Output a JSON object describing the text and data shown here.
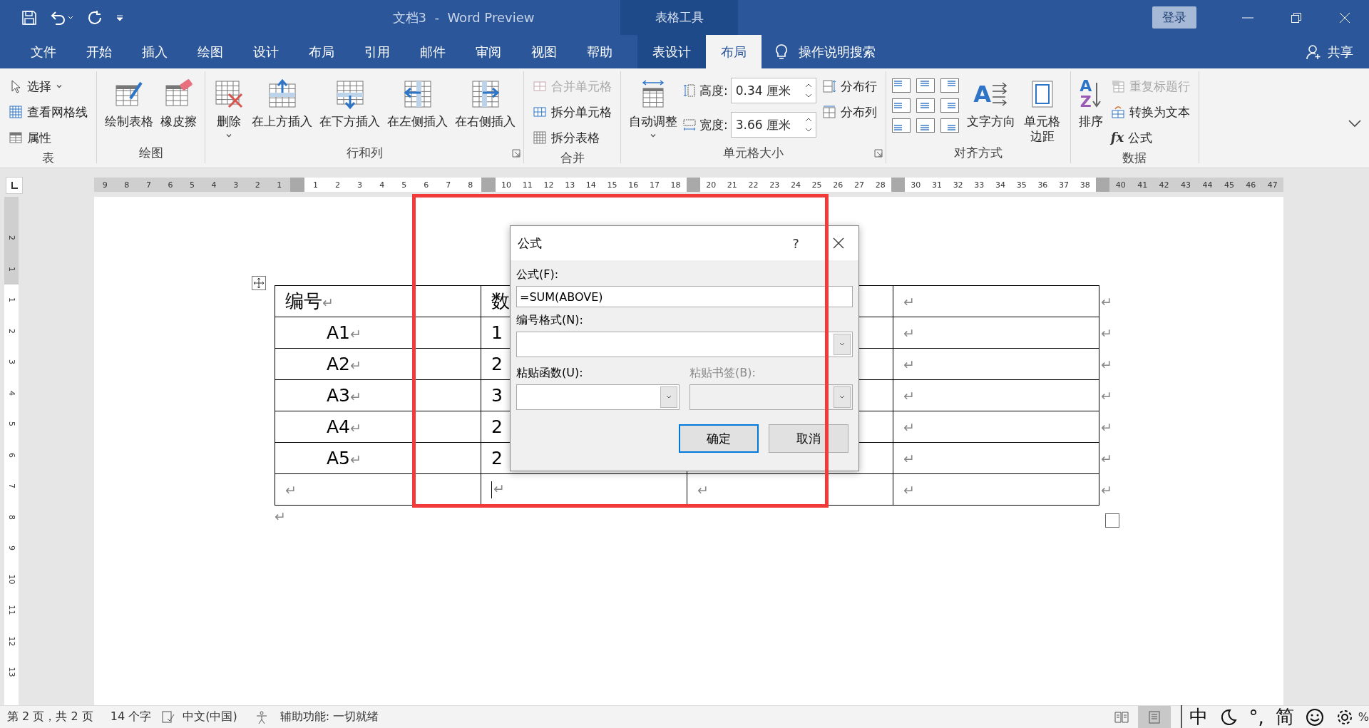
{
  "title_bar": {
    "title": "文档3  -  Word Preview",
    "context_label": "表格工具",
    "login": "登录"
  },
  "menu_tabs": [
    {
      "label": "文件",
      "selected": false,
      "kind": "plain"
    },
    {
      "label": "开始",
      "selected": false,
      "kind": "plain"
    },
    {
      "label": "插入",
      "selected": false,
      "kind": "plain"
    },
    {
      "label": "绘图",
      "selected": false,
      "kind": "plain"
    },
    {
      "label": "设计",
      "selected": false,
      "kind": "plain"
    },
    {
      "label": "布局",
      "selected": false,
      "kind": "plain"
    },
    {
      "label": "引用",
      "selected": false,
      "kind": "plain"
    },
    {
      "label": "邮件",
      "selected": false,
      "kind": "plain"
    },
    {
      "label": "审阅",
      "selected": false,
      "kind": "plain"
    },
    {
      "label": "视图",
      "selected": false,
      "kind": "plain"
    },
    {
      "label": "帮助",
      "selected": false,
      "kind": "plain"
    },
    {
      "label": "表设计",
      "selected": false,
      "kind": "context"
    },
    {
      "label": "布局",
      "selected": true,
      "kind": "context"
    }
  ],
  "search": {
    "label": "操作说明搜索"
  },
  "share": {
    "label": "共享"
  },
  "ribbon": {
    "groups": [
      {
        "label": "表",
        "launcher": false,
        "items": [
          {
            "kind": "small",
            "label": "选择",
            "dropdown": true,
            "disabled": false
          },
          {
            "kind": "small",
            "label": "查看网格线",
            "dropdown": false,
            "disabled": false
          },
          {
            "kind": "small",
            "label": "属性",
            "dropdown": false,
            "disabled": false
          }
        ]
      },
      {
        "label": "绘图",
        "launcher": false,
        "items": [
          {
            "kind": "large",
            "label": "绘制表格",
            "dropdown": false
          },
          {
            "kind": "large",
            "label": "橡皮擦",
            "dropdown": false
          }
        ]
      },
      {
        "label": "行和列",
        "launcher": true,
        "items": [
          {
            "kind": "large",
            "label": "删除",
            "dropdown": true
          },
          {
            "kind": "large",
            "label": "在上方插入",
            "dropdown": false
          },
          {
            "kind": "large",
            "label": "在下方插入",
            "dropdown": false
          },
          {
            "kind": "large",
            "label": "在左侧插入",
            "dropdown": false
          },
          {
            "kind": "large",
            "label": "在右侧插入",
            "dropdown": false
          }
        ]
      },
      {
        "label": "合并",
        "launcher": false,
        "items": [
          {
            "kind": "small",
            "label": "合并单元格",
            "dropdown": false,
            "disabled": true
          },
          {
            "kind": "small",
            "label": "拆分单元格",
            "dropdown": false,
            "disabled": false
          },
          {
            "kind": "small",
            "label": "拆分表格",
            "dropdown": false,
            "disabled": false
          }
        ]
      },
      {
        "label": "单元格大小",
        "launcher": true,
        "items": [
          {
            "kind": "large",
            "label": "自动调整",
            "dropdown": true
          },
          {
            "kind": "spinner",
            "label": "高度:",
            "value": "0.34 厘米"
          },
          {
            "kind": "spinner",
            "label": "宽度:",
            "value": "3.66 厘米"
          },
          {
            "kind": "small",
            "label": "分布行",
            "dropdown": false,
            "disabled": false
          },
          {
            "kind": "small",
            "label": "分布列",
            "dropdown": false,
            "disabled": false
          }
        ]
      },
      {
        "label": "对齐方式",
        "launcher": false,
        "items": [
          {
            "kind": "align_grid"
          },
          {
            "kind": "large",
            "label": "文字方向",
            "dropdown": false,
            "glyphs": [
              "A"
            ]
          },
          {
            "kind": "large",
            "label": "单元格边距",
            "dropdown": false,
            "wrap": true
          }
        ]
      },
      {
        "label": "数据",
        "launcher": false,
        "items": [
          {
            "kind": "large",
            "label": "排序",
            "dropdown": false,
            "glyphs": [
              "A",
              "Z"
            ]
          },
          {
            "kind": "small",
            "label": "重复标题行",
            "dropdown": false,
            "disabled": true
          },
          {
            "kind": "small",
            "label": "转换为文本",
            "dropdown": false,
            "disabled": false
          },
          {
            "kind": "small",
            "label": "公式",
            "dropdown": false,
            "disabled": false,
            "glyphs": [
              "fx"
            ]
          }
        ]
      }
    ]
  },
  "horizontal_ruler": {
    "segments": [
      {
        "kind": "margin",
        "labels": [
          "9",
          "8",
          "7",
          "6",
          "5",
          "4",
          "3",
          "2",
          "1"
        ]
      },
      {
        "kind": "column",
        "labels": [
          "1",
          "2",
          "3",
          "4",
          "5",
          "6",
          "7",
          "8"
        ]
      },
      {
        "kind": "column",
        "labels": [
          "10",
          "11",
          "12",
          "13",
          "14",
          "15",
          "16",
          "17",
          "18"
        ]
      },
      {
        "kind": "column",
        "labels": [
          "20",
          "21",
          "22",
          "23",
          "24",
          "25",
          "26",
          "27",
          "28"
        ]
      },
      {
        "kind": "column",
        "labels": [
          "30",
          "31",
          "32",
          "33",
          "34",
          "35",
          "36",
          "37",
          "38"
        ]
      },
      {
        "kind": "margin",
        "labels": [
          "40",
          "41",
          "42",
          "43",
          "44",
          "45",
          "46",
          "47"
        ]
      }
    ]
  },
  "vertical_ruler": {
    "top_labels": [
      "2",
      "1"
    ],
    "labels": [
      "1",
      "2",
      "3",
      "4",
      "5",
      "6",
      "7",
      "8",
      "9",
      "10",
      "11",
      "12",
      "13"
    ]
  },
  "table": {
    "rows": [
      {
        "cells": [
          {
            "text": "编号",
            "mark": "↵"
          },
          {
            "text": "数"
          },
          {},
          {
            "mark": "↵"
          }
        ],
        "end_mark": "↵"
      },
      {
        "cells": [
          {
            "text": "A1",
            "mark": "↵"
          },
          {
            "text": "1"
          },
          {},
          {
            "mark": "↵"
          }
        ],
        "end_mark": "↵"
      },
      {
        "cells": [
          {
            "text": "A2",
            "mark": "↵"
          },
          {
            "text": "2"
          },
          {},
          {
            "mark": "↵"
          }
        ],
        "end_mark": "↵"
      },
      {
        "cells": [
          {
            "text": "A3",
            "mark": "↵"
          },
          {
            "text": "3"
          },
          {},
          {
            "mark": "↵"
          }
        ],
        "end_mark": "↵"
      },
      {
        "cells": [
          {
            "text": "A4",
            "mark": "↵"
          },
          {
            "text": "2"
          },
          {},
          {
            "mark": "↵"
          }
        ],
        "end_mark": "↵"
      },
      {
        "cells": [
          {
            "text": "A5",
            "mark": "↵"
          },
          {
            "text": "2"
          },
          {},
          {
            "mark": "↵"
          }
        ],
        "end_mark": "↵"
      },
      {
        "cells": [
          {
            "mark": "↵",
            "cursor": false
          },
          {
            "mark": "↵",
            "cursor": true
          },
          {
            "mark": "↵",
            "cursor": false
          },
          {
            "mark": "↵",
            "cursor": false
          }
        ],
        "end_mark": "↵"
      }
    ],
    "after_mark": "↵"
  },
  "dialog": {
    "title": "公式",
    "help": "?",
    "fields": [
      {
        "kind": "text",
        "label": "公式(F):",
        "value": "=SUM(ABOVE)"
      },
      {
        "kind": "select",
        "label": "编号格式(N):"
      }
    ],
    "pickers": [
      {
        "label": "粘贴函数(U):",
        "disabled": false
      },
      {
        "label": "粘贴书签(B):",
        "disabled": true
      }
    ],
    "buttons": [
      {
        "label": "确定",
        "default": true
      },
      {
        "label": "取消",
        "default": false
      }
    ]
  },
  "annotation": {
    "kind": "rectangle"
  },
  "status_bar": {
    "page": "第 2 页，共 2 页",
    "words": "14 个字",
    "language": "中文(中国)",
    "accessibility": "辅助功能: 一切就绪",
    "views": [
      {
        "kind": "read",
        "selected": false
      },
      {
        "kind": "print",
        "selected": true
      }
    ],
    "ime": {
      "mode": "中",
      "punct": "°,",
      "script": "简"
    },
    "zoom_fragment": "%"
  }
}
